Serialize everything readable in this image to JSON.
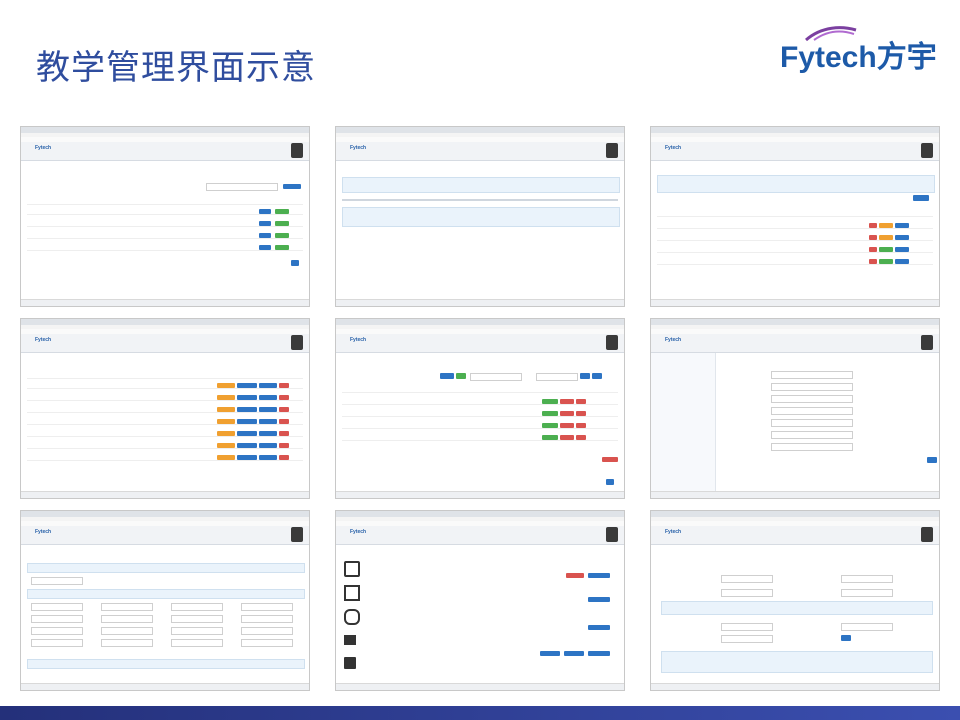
{
  "slide": {
    "title": "教学管理界面示意",
    "logo_text": "Fytech方宇",
    "colors": {
      "title": "#2f4d9e",
      "brand": "#1d5aa8",
      "footer": "#2a3a8f"
    }
  },
  "thumbnails": [
    {
      "name": "thumb-1",
      "icon": "table-list-view"
    },
    {
      "name": "thumb-2",
      "icon": "info-panels-view"
    },
    {
      "name": "thumb-3",
      "icon": "table-actions-view"
    },
    {
      "name": "thumb-4",
      "icon": "table-buttons-view"
    },
    {
      "name": "thumb-5",
      "icon": "grid-data-view"
    },
    {
      "name": "thumb-6",
      "icon": "form-sidebar-view"
    },
    {
      "name": "thumb-7",
      "icon": "long-form-view"
    },
    {
      "name": "thumb-8",
      "icon": "tool-cards-view"
    },
    {
      "name": "thumb-9",
      "icon": "settings-form-view"
    }
  ]
}
